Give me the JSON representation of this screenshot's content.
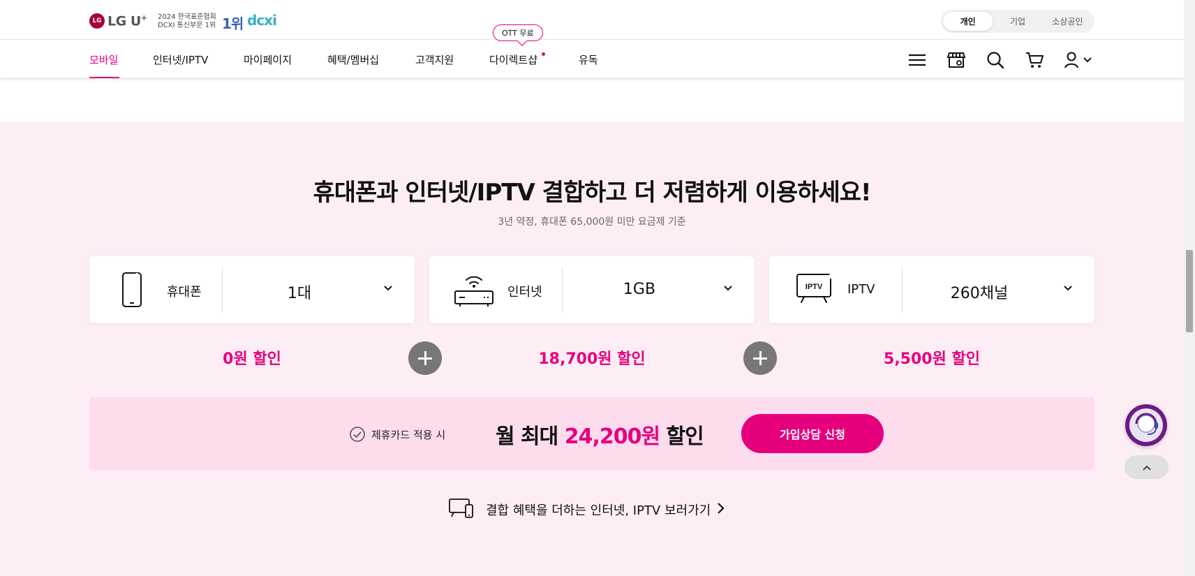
{
  "header": {
    "logo_mark": "LG",
    "logo_text": "LG U",
    "logo_plus": "+",
    "award_line1": "2024 한국표준협회",
    "award_line2": "DCXI 통신부문 1위",
    "award_rank": "1위",
    "award_brand": "dcxi",
    "segments": [
      "개인",
      "기업",
      "소상공인"
    ],
    "active_segment": "개인"
  },
  "nav": {
    "items": [
      "모바일",
      "인터넷/IPTV",
      "마이페이지",
      "혜택/멤버십",
      "고객지원",
      "다이렉트샵",
      "유독"
    ],
    "active": "모바일",
    "ott_badge": "OTT 무료",
    "icons": [
      "menu-icon",
      "store-icon",
      "search-icon",
      "cart-icon",
      "user-icon"
    ]
  },
  "promo": {
    "headline": "휴대폰과 인터넷/IPTV 결합하고 더 저렴하게 이용하세요!",
    "subline": "3년 약정, 휴대폰 65,000원 미만 요금제 기준",
    "cards": [
      {
        "label": "휴대폰",
        "value": "1대",
        "icon": "phone-icon"
      },
      {
        "label": "인터넷",
        "value": "1GB",
        "icon": "router-icon"
      },
      {
        "label": "IPTV",
        "value": "260채널",
        "icon": "tv-icon",
        "icon_text": "IPTV"
      }
    ],
    "discounts": [
      "0원 할인",
      "18,700원 할인",
      "5,500원 할인"
    ],
    "card_condition": "제휴카드 적용 시",
    "total_prefix": "월 최대 ",
    "total_amount": "24,200원",
    "total_suffix": " 할인",
    "apply_button": "가입상담 신청",
    "more_link": "결합 혜택을 더하는 인터넷, IPTV 보러가기"
  },
  "colors": {
    "accent": "#e6007e",
    "section_bg": "#fdeef5",
    "total_bg": "#fcdced",
    "plus_bg": "#777777"
  }
}
